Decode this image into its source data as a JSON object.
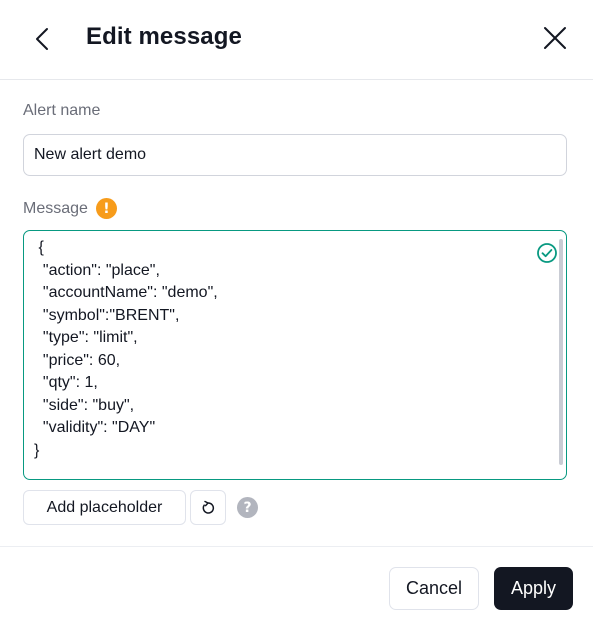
{
  "header": {
    "title": "Edit message",
    "back_icon": "chevron-left-icon",
    "close_icon": "close-icon"
  },
  "alert_name": {
    "label": "Alert name",
    "value": "New alert demo"
  },
  "message": {
    "label": "Message",
    "warning_icon": "warning-icon",
    "warning_glyph": "!",
    "valid_icon": "check-circle-icon",
    "value": " {\n  \"action\": \"place\",\n  \"accountName\": \"demo\",\n  \"symbol\":\"BRENT\",\n  \"type\": \"limit\",\n  \"price\": 60,\n  \"qty\": 1,\n  \"side\": \"buy\",\n  \"validity\": \"DAY\"\n}"
  },
  "toolbar": {
    "add_placeholder_label": "Add placeholder",
    "reset_icon": "reset-icon",
    "help_icon": "help-icon",
    "help_glyph": "?"
  },
  "footer": {
    "cancel_label": "Cancel",
    "apply_label": "Apply"
  },
  "colors": {
    "accent_valid": "#089981",
    "warning": "#f79c1b",
    "primary_button": "#131722"
  }
}
